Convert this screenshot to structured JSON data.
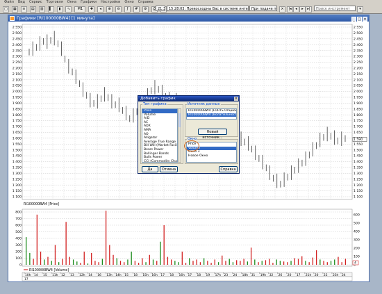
{
  "menu": [
    "Файл",
    "Вид",
    "Сервис",
    "Торговля",
    "Окна",
    "Графики",
    "Настройки",
    "Окно",
    "Справка"
  ],
  "toolbar": {
    "timeframe": "M1",
    "status_time": "21:3",
    "notification": "15:28:03: Превосходны Вас в системе интернет-трейдинга!",
    "notification2": "При подаче поз",
    "search_placeholder": "Поиск инструмент"
  },
  "window": {
    "title": "Графики [RI100000BW4] [1 минута]"
  },
  "chart": {
    "y_ticks": [
      "2 550",
      "2 500",
      "2 450",
      "2 400",
      "2 350",
      "2 300",
      "2 250",
      "2 200",
      "2 150",
      "2 100",
      "2 050",
      "2 000",
      "1 950",
      "1 900",
      "1 850",
      "1 800",
      "1 750",
      "1 700",
      "1 650",
      "1 600",
      "1 550",
      "1 500",
      "1 450",
      "1 400",
      "1 350",
      "1 300",
      "1 250",
      "1 200",
      "1 150",
      "1 100"
    ],
    "price_marker": "1 590",
    "price_label": "RI100000BW4 [Price]",
    "vol_ticks": [
      "800",
      "700",
      "600",
      "500",
      "400",
      "300",
      "200",
      "100",
      "0"
    ],
    "vol_right_ticks": [
      "600",
      "500",
      "400",
      "300",
      "200",
      "100",
      "0"
    ],
    "vol_marker": "4",
    "vol_label": "RI100000BW4 [Volume]",
    "x_labels": [
      "10h",
      "14",
      "15",
      "11h",
      "12",
      "13",
      "12h",
      "14",
      "16",
      "13h",
      "14h",
      "15",
      "18",
      "15h",
      "16h",
      "17",
      "18",
      "16h",
      "17",
      "18",
      "19",
      "17h",
      "23",
      "24",
      "18h",
      "31",
      "19h",
      "32",
      "26",
      "20",
      "17",
      "21h",
      "20",
      "22",
      "23h",
      "24"
    ],
    "x_labels_bottom": [
      "17"
    ],
    "price_series": [
      2330,
      2350,
      2370,
      2395,
      2420,
      2410,
      2430,
      2440,
      2400,
      2350,
      2270,
      2200,
      2160,
      2110,
      2060,
      2000,
      1960,
      1910,
      1890,
      1900,
      1930,
      1960,
      1940,
      1900,
      1880,
      1870,
      1830,
      1800,
      1760,
      1780,
      1820,
      1860,
      1900,
      1950,
      2000,
      2020,
      2010,
      1980,
      1950,
      1920,
      1900,
      1910,
      1890,
      1870,
      1850,
      1840,
      1830,
      1800,
      1760,
      1720,
      1700,
      1710,
      1730,
      1720,
      1700,
      1680,
      1650,
      1620,
      1600,
      1580,
      1560,
      1540,
      1500,
      1460,
      1420,
      1380,
      1340,
      1290,
      1250,
      1220,
      1200,
      1230,
      1260,
      1290,
      1320,
      1350,
      1380,
      1410,
      1450,
      1490,
      1530,
      1570,
      1600,
      1620,
      1610,
      1590,
      1570,
      1580,
      1590
    ],
    "volume_series": [
      420,
      180,
      90,
      760,
      200,
      80,
      120,
      60,
      300,
      40,
      90,
      650,
      120,
      80,
      50,
      30,
      200,
      20,
      180,
      60,
      40,
      90,
      820,
      300,
      150,
      100,
      60,
      40,
      80,
      200,
      60,
      30,
      100,
      40,
      150,
      80,
      60,
      350,
      600,
      120,
      80,
      60,
      40,
      200,
      30,
      100,
      60,
      80,
      40,
      100,
      60,
      30,
      80,
      40,
      140,
      60,
      90,
      40,
      70,
      60,
      90,
      50,
      260,
      80,
      40,
      60,
      70,
      90,
      30,
      80,
      60,
      50,
      40,
      60,
      100,
      90,
      130,
      60,
      40,
      110,
      220,
      80,
      60,
      40,
      60,
      80,
      120,
      40,
      90
    ]
  },
  "dialog": {
    "title": "Добавить график",
    "type_group": "Тип графика",
    "types": [
      "Price",
      "Volume",
      "A/D",
      "AC",
      "ADX",
      "AMA",
      "AO",
      "Alligator",
      "Average True Range",
      "Bill Will (Market Facilitat",
      "Bears Power",
      "Bollinger Bands",
      "Bulls Power",
      "CCI (Commodity Channel I"
    ],
    "type_selected": 0,
    "source_group": "Источник данных",
    "sources": [
      "RI100000BW4 [FORTS Опционы]",
      "RI100000BW4 [Волатильность FORTS]"
    ],
    "source_selected": 1,
    "new_source_button": "Новый источник...",
    "area_group": "Окно",
    "areas": [
      "Price",
      "Volume",
      "Окно 3",
      "Новое Окно"
    ],
    "area_selected": 1,
    "ok": "Да",
    "cancel": "Отмена",
    "help": "Справка"
  },
  "colors": {
    "background": "#a8b6c8",
    "title_bar": "#2d58a6",
    "dialog_bg": "#ece9d8",
    "selection": "#316ac5",
    "volume_up": "#1a8a1a",
    "volume_down": "#d22020",
    "annotation_circle": "#d2691e"
  }
}
